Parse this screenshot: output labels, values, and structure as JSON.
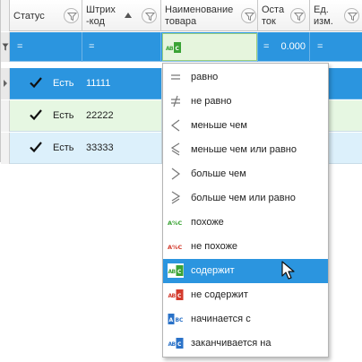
{
  "columns": {
    "status": "Статус",
    "barcode_line1": "Штрих",
    "barcode_line2": "-код",
    "name_line1": "Наименование",
    "name_line2": "товара",
    "stock_line1": "Оста",
    "stock_line2": "ток",
    "unit_line1": "Ед.",
    "unit_line2": "изм."
  },
  "filter_row": {
    "status_op": "=",
    "barcode_op": "=",
    "stock_op": "=",
    "stock_value": "0.000",
    "unit_op": "="
  },
  "rows": [
    {
      "status": "Есть",
      "barcode": "11111"
    },
    {
      "status": "Есть",
      "barcode": "22222"
    },
    {
      "status": "Есть",
      "barcode": "33333"
    }
  ],
  "operators": [
    {
      "icon": "equals-icon",
      "label": "равно"
    },
    {
      "icon": "not-equals-icon",
      "label": "не равно"
    },
    {
      "icon": "less-than-icon",
      "label": "меньше чем"
    },
    {
      "icon": "less-or-equal-icon",
      "label": "меньше чем или равно"
    },
    {
      "icon": "greater-than-icon",
      "label": "больше чем"
    },
    {
      "icon": "greater-or-equal-icon",
      "label": "больше чем или равно"
    },
    {
      "icon": "like-icon",
      "label": "похоже"
    },
    {
      "icon": "not-like-icon",
      "label": "не похоже"
    },
    {
      "icon": "contains-icon",
      "label": "содержит"
    },
    {
      "icon": "not-contains-icon",
      "label": "не содержит"
    },
    {
      "icon": "starts-with-icon",
      "label": "начинается с"
    },
    {
      "icon": "ends-with-icon",
      "label": "заканчивается на"
    }
  ],
  "selected_operator": "содержит",
  "icon_glyphs": {
    "like": "A%C",
    "abc": "ABC"
  },
  "colors": {
    "selection": "#2b95df",
    "row_green": "#e6f7e2",
    "row_blue": "#dcf0fb",
    "icon_green": "#3aa335",
    "icon_red": "#d33a2c",
    "icon_blue": "#2a72c8"
  }
}
